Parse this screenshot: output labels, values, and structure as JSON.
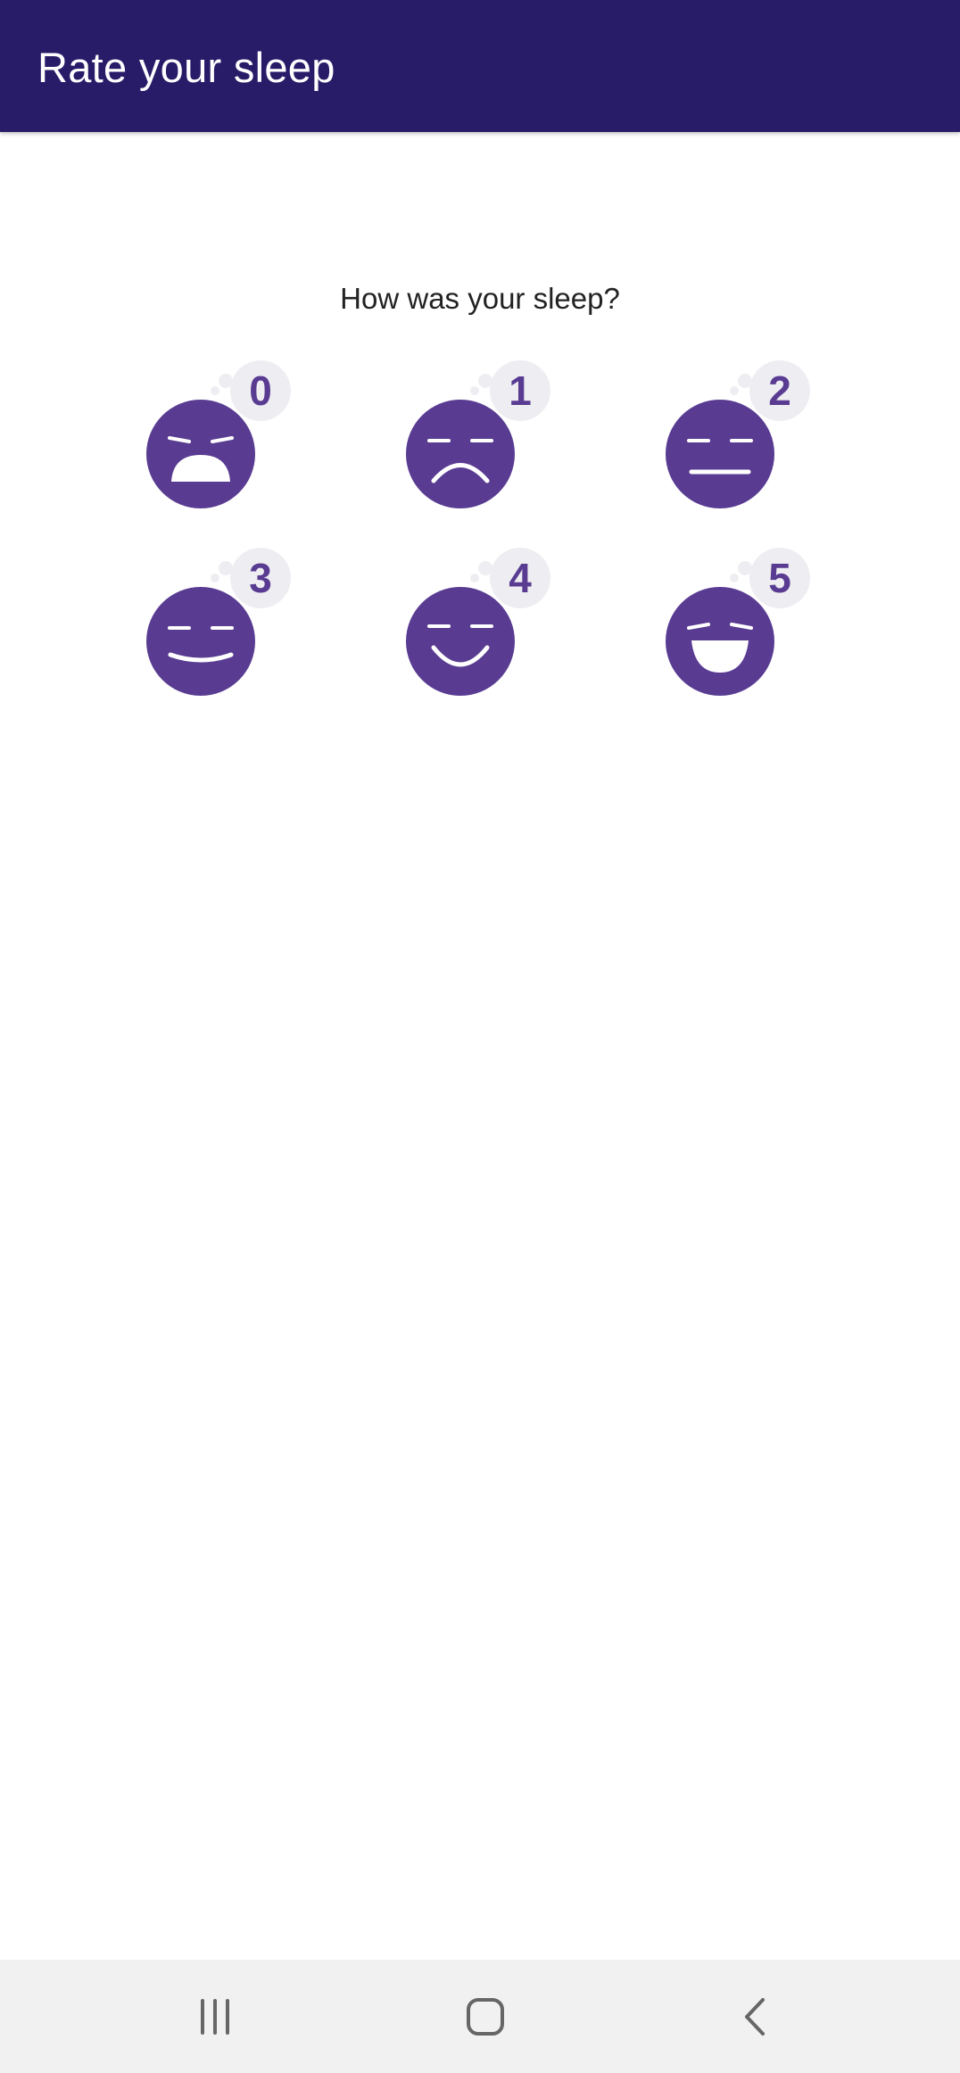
{
  "app_bar": {
    "title": "Rate your sleep"
  },
  "main": {
    "question": "How was your sleep?",
    "ratings": [
      {
        "value": "0",
        "icon": "very-sad-face-icon"
      },
      {
        "value": "1",
        "icon": "sad-face-icon"
      },
      {
        "value": "2",
        "icon": "neutral-face-icon"
      },
      {
        "value": "3",
        "icon": "slight-smile-face-icon"
      },
      {
        "value": "4",
        "icon": "smile-face-icon"
      },
      {
        "value": "5",
        "icon": "laughing-face-icon"
      }
    ]
  },
  "system_nav": {
    "recents_icon": "recents-icon",
    "home_icon": "home-icon",
    "back_icon": "back-icon"
  },
  "colors": {
    "app_bar": "#281c69",
    "face": "#593c92",
    "badge_bg": "#eeeef2",
    "nav_bar": "#f1f1f1"
  }
}
